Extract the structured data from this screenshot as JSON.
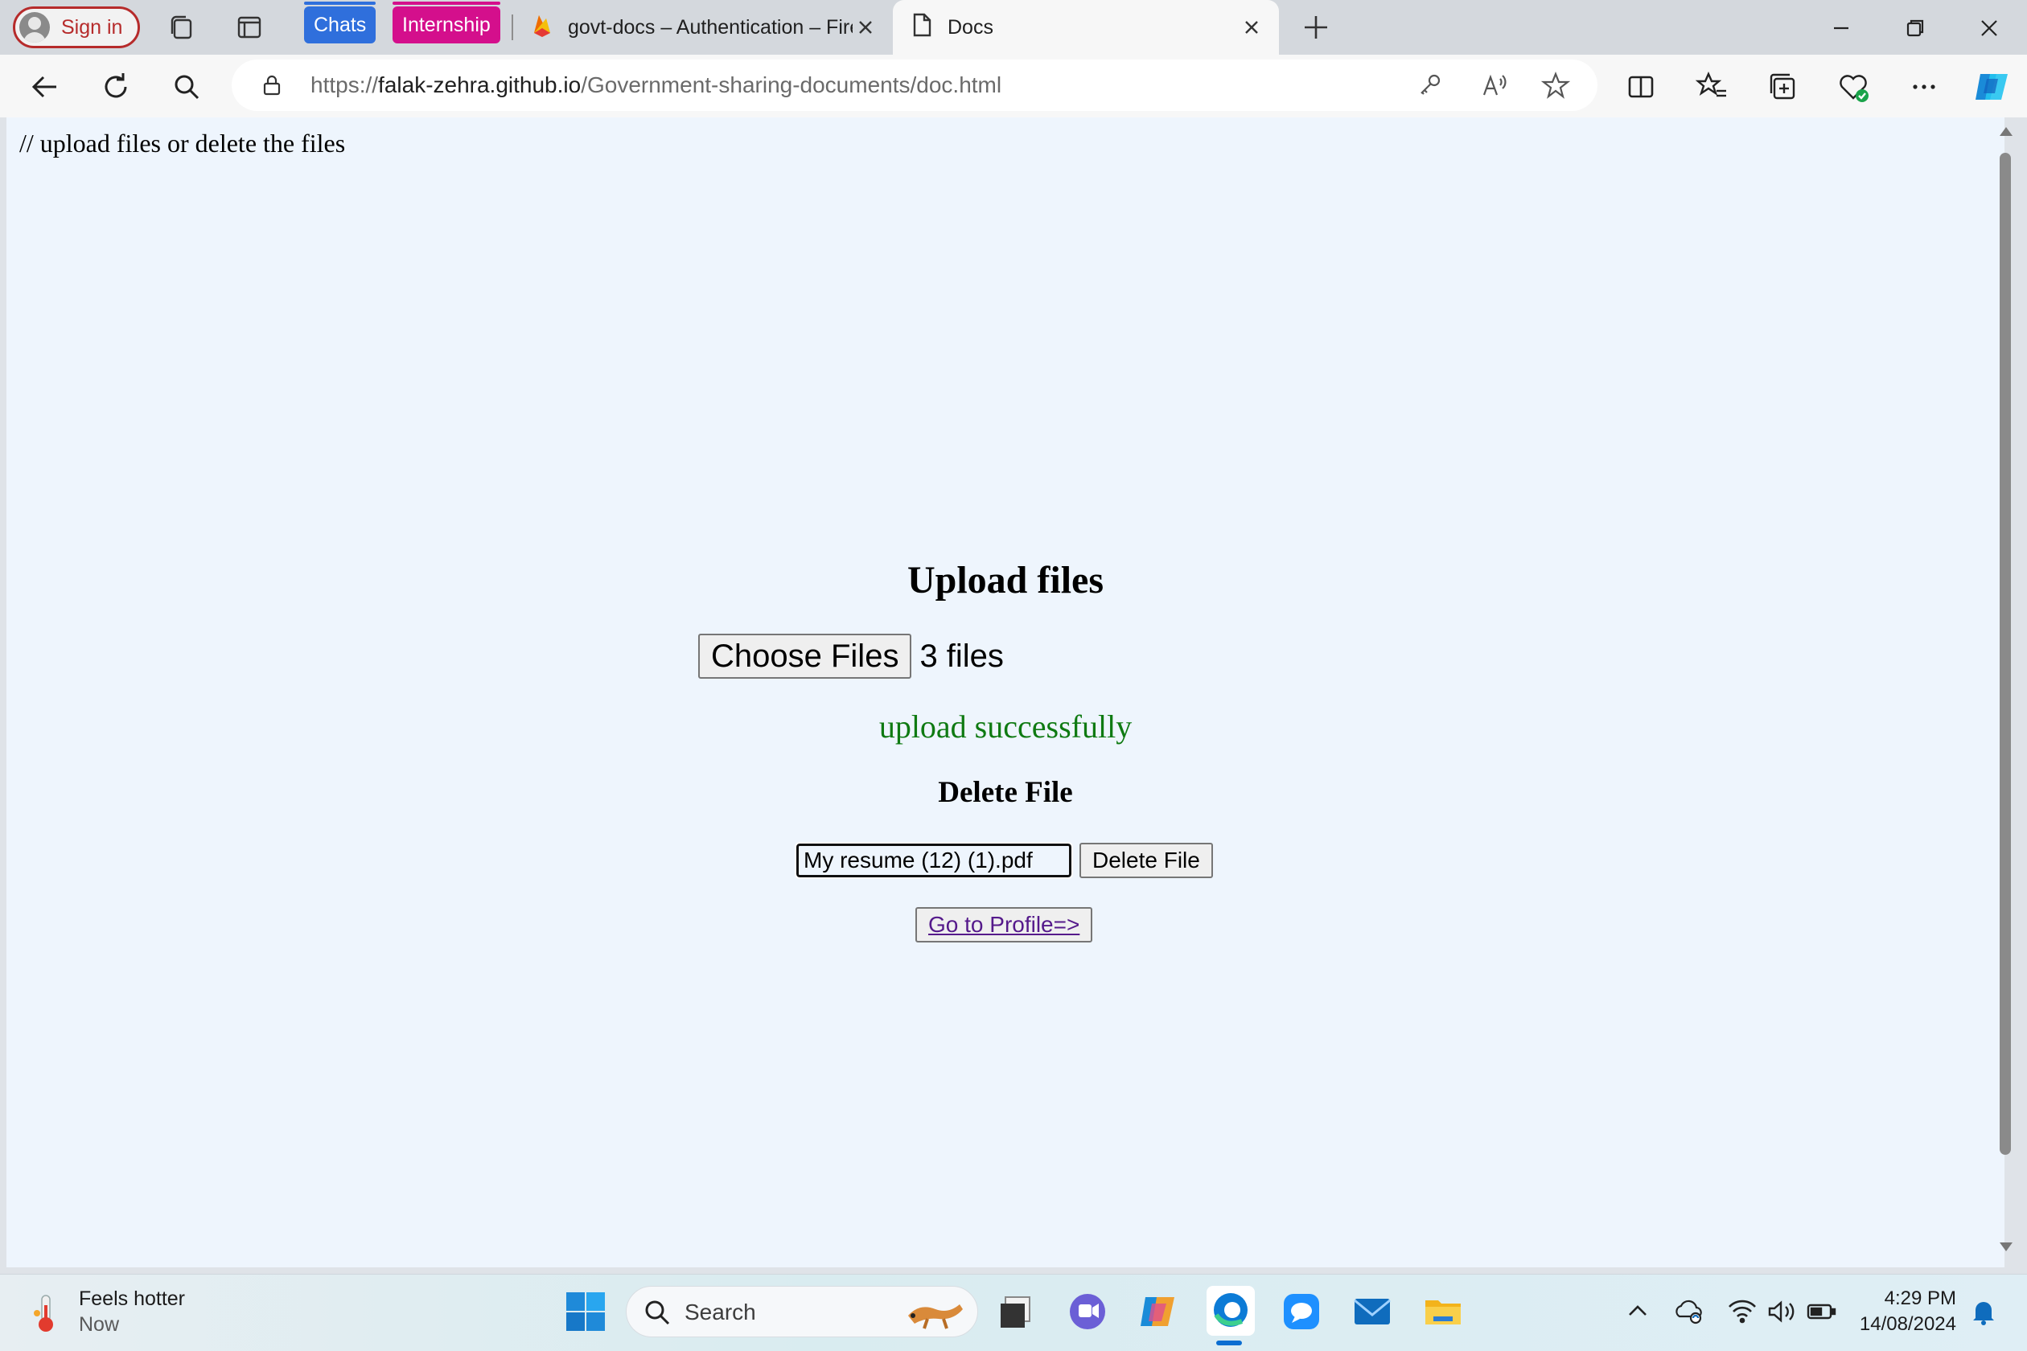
{
  "browser": {
    "signin_label": "Sign in",
    "tab_groups": [
      {
        "label": "Chats",
        "color": "#2f6fdc"
      },
      {
        "label": "Internship",
        "color": "#d40f8c"
      }
    ],
    "tabs": [
      {
        "title": "govt-docs – Authentication – Fire",
        "active": false
      },
      {
        "title": "Docs",
        "active": true
      }
    ],
    "address": {
      "prefix": "https://",
      "host": "falak-zehra.github.io",
      "path": "/Government-sharing-documents/doc.html"
    }
  },
  "page": {
    "comment": "// upload files or delete the files",
    "upload_heading": "Upload files",
    "choose_button": "Choose Files",
    "file_count": "3 files",
    "status_message": "upload successfully",
    "delete_heading": "Delete File",
    "delete_input_value": "My resume (12) (1).pdf",
    "delete_button": "Delete File",
    "profile_link": "Go to Profile=>"
  },
  "taskbar": {
    "weather_title": "Feels hotter",
    "weather_sub": "Now",
    "search_label": "Search",
    "time": "4:29 PM",
    "date": "14/08/2024"
  }
}
